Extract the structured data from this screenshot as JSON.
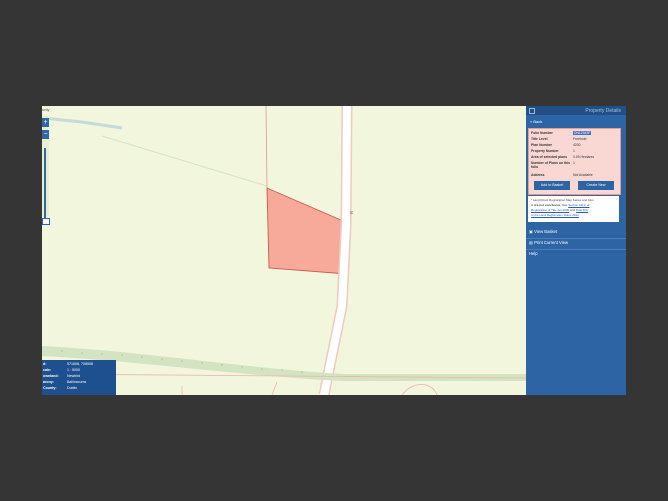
{
  "map": {
    "road_label": "R",
    "corner_label": "unty"
  },
  "zoom": {
    "in_label": "+",
    "out_label": "−"
  },
  "info_box": {
    "rows": [
      {
        "key": "d:",
        "value": "571808, 708508"
      },
      {
        "key": "cale:",
        "value": "1 : 5000"
      },
      {
        "key": "ownland:",
        "value": "Newbird"
      },
      {
        "key": "arony:",
        "value": "Ballinacurra"
      },
      {
        "key": "County:",
        "value": "Dublin"
      }
    ]
  },
  "panel": {
    "title": "Property Details",
    "back_label": "Back",
    "card": {
      "rows": [
        {
          "key": "Folio Number",
          "value": "DN12345F"
        },
        {
          "key": "Title Level",
          "value": "Freehold"
        },
        {
          "key": "Plan Number",
          "value": "4200"
        },
        {
          "key": "Property Number",
          "value": "1"
        },
        {
          "key": "Area of selected plans",
          "value": "0.09 Hectares"
        },
        {
          "key": "Number of Plans on this folio",
          "value": "1"
        },
        {
          "key": "Address",
          "value": "Not Available"
        }
      ],
      "add_basket_label": "Add to Basket",
      "create_new_label": "Create New"
    },
    "note": {
      "line1": "* Land Direct Registration Map Series and folio",
      "line2_pre": "is ",
      "line2_bold": "are not conclusive",
      "line2_post": ". See ",
      "line2_link": "Section 62(1) of",
      "line3_link": "Registration of Title Act 2006",
      "line3_mid": " and ",
      "line3_link2": "Rule 8(1)",
      "line4_link": "of the Land Registration Rules 2012"
    },
    "links": {
      "view_basket": "View Basket",
      "print_view": "Print Current View",
      "help": "Help"
    },
    "colors": {
      "panel_bg": "#2c64a4",
      "card_bg": "#f9d8d4",
      "parcel_fill": "#f7a99a"
    }
  }
}
